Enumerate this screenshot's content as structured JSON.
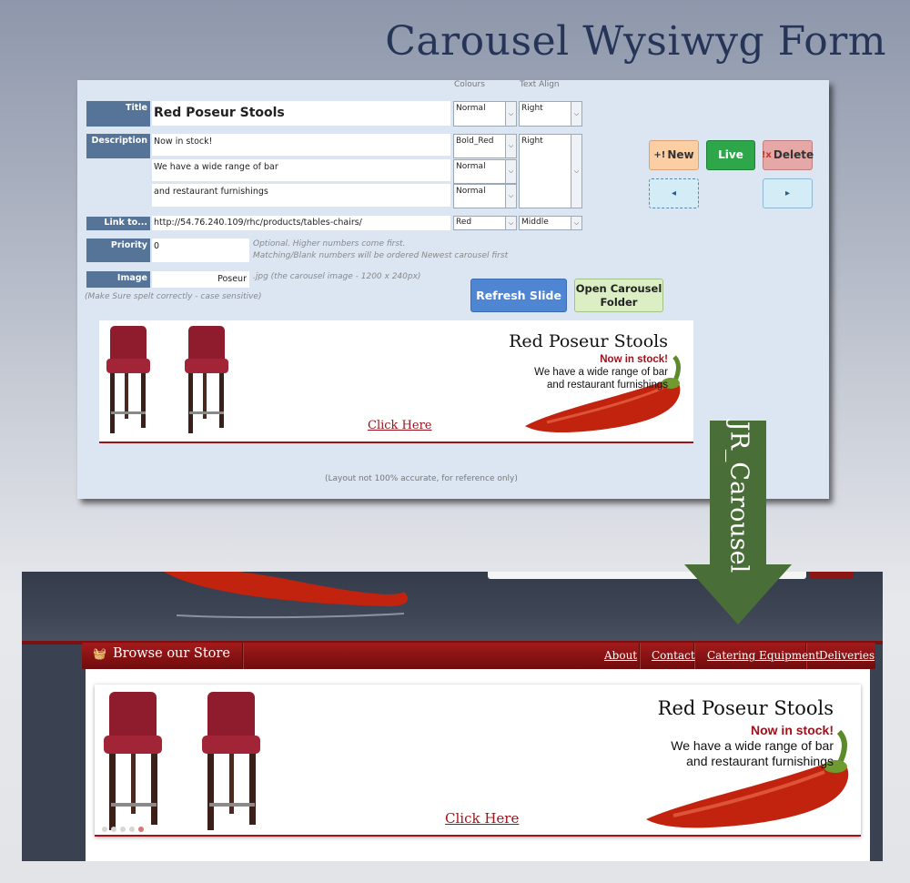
{
  "heading": "Carousel Wysiwyg Form",
  "form": {
    "headers": {
      "colours": "Colours",
      "text_align": "Text Align"
    },
    "title": {
      "label": "Title",
      "value": "Red Poseur Stools",
      "colour": "Normal",
      "align": "Right"
    },
    "description": {
      "label": "Description",
      "lines": [
        "Now in stock!",
        "We have a wide range of bar",
        "and restaurant furnishings"
      ],
      "colours": [
        "Bold_Red",
        "Normal",
        "Normal"
      ],
      "align": "Right"
    },
    "link": {
      "label": "Link to...",
      "value": "http://54.76.240.109/rhc/products/tables-chairs/",
      "colour": "Red",
      "align": "Middle"
    },
    "priority": {
      "label": "Priority",
      "value": "0",
      "note1": "Optional. Higher numbers come first.",
      "note2": "Matching/Blank numbers will be ordered Newest carousel first"
    },
    "image": {
      "label": "Image",
      "value": "Poseur",
      "note": ".jpg (the carousel image - 1200 x 240px)",
      "spell_note": "(Make Sure spelt correctly - case sensitive)"
    },
    "buttons": {
      "new": "New",
      "new_icon": "+!",
      "live": "Live",
      "delete": "Delete",
      "delete_icon": "!x",
      "prev": "◂",
      "next": "▸",
      "refresh": "Refresh Slide",
      "open_folder_line1": "Open Carousel",
      "open_folder_line2": "Folder"
    },
    "preview": {
      "title": "Red Poseur Stools",
      "line1": "Now in stock!",
      "line2": "We have a wide range of bar",
      "line3": "and restaurant furnishings",
      "click": "Click Here"
    },
    "footer_note": "(Layout not 100% accurate, for reference only)"
  },
  "arrow": {
    "label": "JR_Carousel",
    "color": "#4a6e37"
  },
  "site": {
    "nav": {
      "store": "Browse our Store",
      "links": [
        "About",
        "Contact",
        "Catering Equipment",
        "Deliveries"
      ]
    },
    "slide": {
      "title": "Red Poseur Stools",
      "line1": "Now in stock!",
      "line2": "We have a wide range of bar",
      "line3": "and restaurant furnishings",
      "click": "Click Here"
    },
    "slide_count": 5,
    "active_slide": 5
  },
  "colors": {
    "brand_red": "#a0121b",
    "label_blue": "#567398",
    "form_bg": "#dce6f3"
  }
}
